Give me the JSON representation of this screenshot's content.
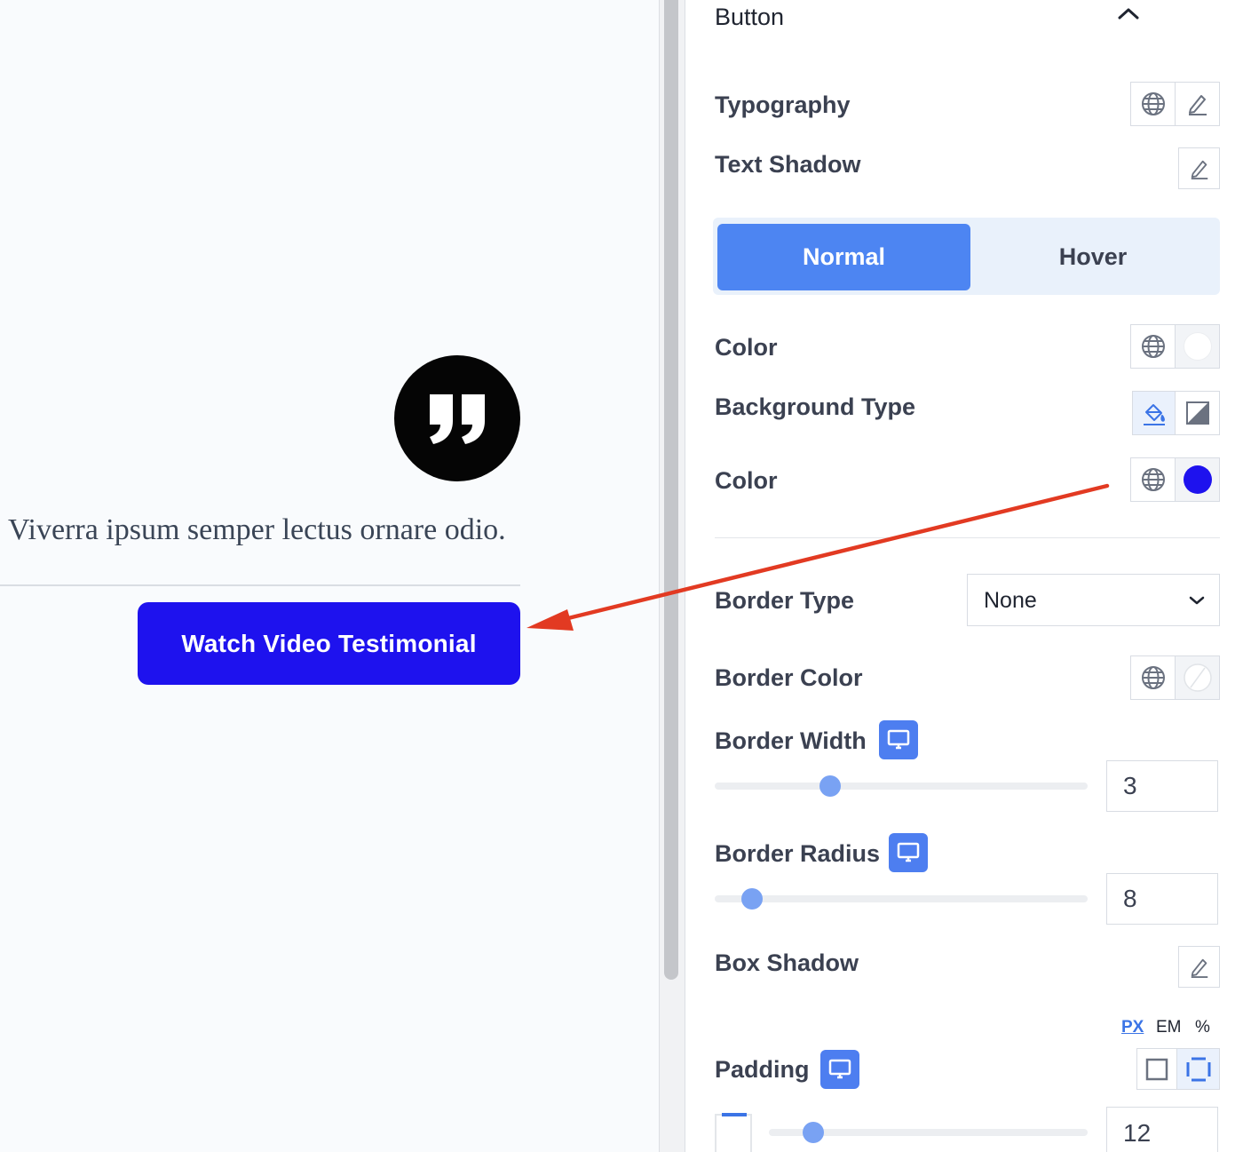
{
  "preview": {
    "quote_text": "Viverra ipsum semper lectus ornare odio.",
    "button_label": "Watch Video Testimonial",
    "button_color": "#1e12ee"
  },
  "panel": {
    "section_title": "Button",
    "typography_label": "Typography",
    "text_shadow_label": "Text Shadow",
    "tabs": {
      "normal": "Normal",
      "hover": "Hover",
      "active": "Normal",
      "active_color": "#4d85f2"
    },
    "color_label": "Color",
    "text_color_value": "#ffffff",
    "background_type_label": "Background Type",
    "bg_color_label": "Color",
    "bg_color_value": "#1e12ee",
    "border_type_label": "Border Type",
    "border_type_value": "None",
    "border_color_label": "Border Color",
    "border_width": {
      "label": "Border Width",
      "value": "3",
      "fraction": 0.31
    },
    "border_radius": {
      "label": "Border Radius",
      "value": "8",
      "fraction": 0.1
    },
    "box_shadow_label": "Box Shadow",
    "units": [
      "PX",
      "EM",
      "%"
    ],
    "active_unit": "PX",
    "padding": {
      "label": "Padding",
      "value": "12",
      "fraction": 0.14
    }
  }
}
